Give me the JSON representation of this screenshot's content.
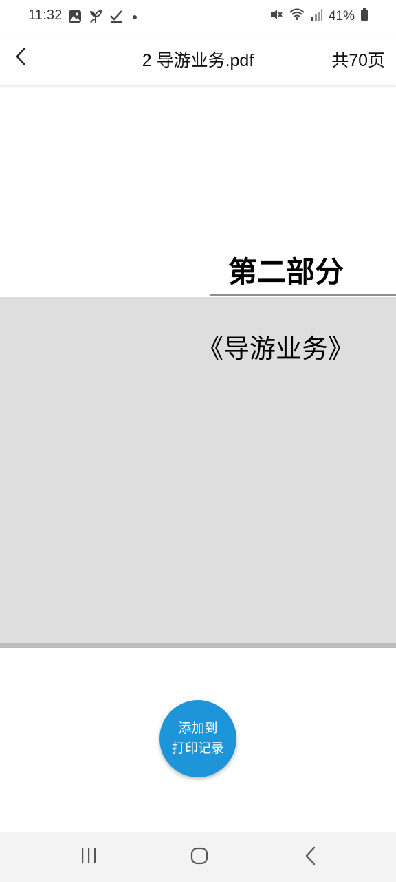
{
  "status_bar": {
    "time": "11:32",
    "battery_percent": "41%",
    "left_icons": [
      "gallery-icon",
      "leaf-icon",
      "check-icon",
      "dot-icon"
    ],
    "right_icons": [
      "mute-icon",
      "wifi-icon",
      "signal-icon",
      "battery-icon"
    ]
  },
  "header": {
    "back_icon": "chevron-left-icon",
    "title": "2 导游业务.pdf",
    "page_count": "共70页"
  },
  "document": {
    "section_heading": "第二部分",
    "section_subtitle": "《导游业务》"
  },
  "fab": {
    "line1": "添加到",
    "line2": "打印记录",
    "color": "#1e95d9"
  },
  "nav_bar": {
    "buttons": [
      "recent-apps-icon",
      "home-icon",
      "back-icon"
    ]
  }
}
